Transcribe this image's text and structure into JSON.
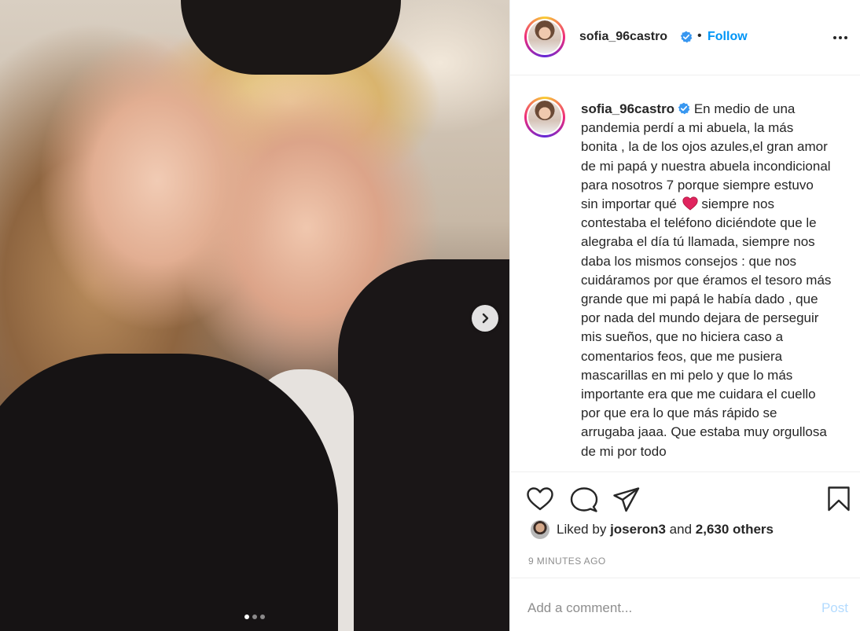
{
  "post": {
    "username": "sofia_96castro",
    "follow_label": "Follow",
    "bullet": "•",
    "caption": "En medio de una pandemia perdí a mi abuela, la más bonita , la de los ojos azules,el gran amor de mi papá y nuestra abuela incondicional para nosotros 7 porque siempre estuvo sin importar qué",
    "caption_continued": "siempre nos contestaba el teléfono diciéndote que le alegraba el día tú llamada, siempre nos daba los mismos consejos : que nos cuidáramos por que éramos el tesoro más grande que mi papá le había dado , que por nada del mundo dejara de perseguir mis sueños, que no hiciera caso a comentarios feos, que me pusiera mascarillas en mi pelo y que lo más importante era que me cuidara el cuello por que era lo que más rápido se arrugaba jaaa. Que estaba muy orgullosa de mi por todo",
    "liked_by_prefix": "Liked by",
    "liked_by_user": "joseron3",
    "liked_by_and": "and",
    "liked_by_others": "2,630 others",
    "timestamp": "9 MINUTES AGO",
    "comment_placeholder": "Add a comment...",
    "post_label": "Post"
  },
  "carousel": {
    "total": 3,
    "active_index": 0
  },
  "icons": {
    "verified": "verified-badge-icon",
    "more": "more-options-icon",
    "next": "chevron-right-icon",
    "like": "heart-outline-icon",
    "comment": "comment-bubble-icon",
    "share": "paper-plane-icon",
    "save": "bookmark-icon",
    "emoji": "red-heart-emoji"
  },
  "colors": {
    "accent": "#0095f6",
    "post_disabled": "#b3dbff",
    "text": "#262626",
    "muted": "#8e8e8e",
    "verified": "#3897f0"
  }
}
